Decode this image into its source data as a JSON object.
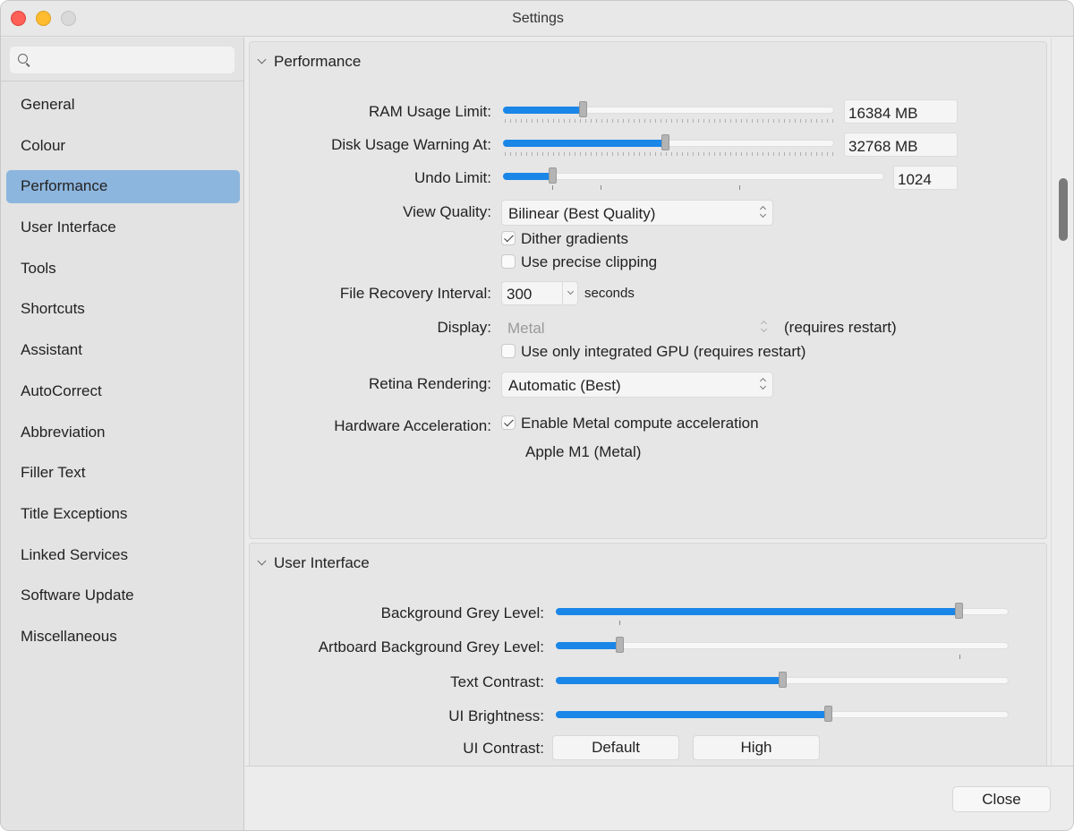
{
  "window": {
    "title": "Settings"
  },
  "search": {
    "placeholder": ""
  },
  "sidebar": {
    "items": [
      {
        "label": "General"
      },
      {
        "label": "Colour"
      },
      {
        "label": "Performance",
        "active": true
      },
      {
        "label": "User Interface"
      },
      {
        "label": "Tools"
      },
      {
        "label": "Shortcuts"
      },
      {
        "label": "Assistant"
      },
      {
        "label": "AutoCorrect"
      },
      {
        "label": "Abbreviation"
      },
      {
        "label": "Filler Text"
      },
      {
        "label": "Title Exceptions"
      },
      {
        "label": "Linked Services"
      },
      {
        "label": "Software Update"
      },
      {
        "label": "Miscellaneous"
      }
    ]
  },
  "performance": {
    "header": "Performance",
    "ram": {
      "label": "RAM Usage Limit:",
      "value": "16384 MB",
      "level": 0.24
    },
    "disk": {
      "label": "Disk Usage Warning At:",
      "value": "32768 MB",
      "level": 0.49
    },
    "undo": {
      "label": "Undo Limit:",
      "value": "1024",
      "level": 0.13
    },
    "view_quality": {
      "label": "View Quality:",
      "value": "Bilinear (Best Quality)"
    },
    "dither": {
      "label": "Dither gradients",
      "checked": true
    },
    "precise_clipping": {
      "label": "Use precise clipping",
      "checked": false
    },
    "file_recovery": {
      "label": "File Recovery Interval:",
      "value": "300",
      "unit": "seconds"
    },
    "display": {
      "label": "Display:",
      "value": "Metal",
      "note": "(requires restart)"
    },
    "integrated_gpu": {
      "label": "Use only integrated GPU (requires restart)",
      "checked": false
    },
    "retina": {
      "label": "Retina Rendering:",
      "value": "Automatic (Best)"
    },
    "hw_accel": {
      "label": "Hardware Acceleration:",
      "checkbox": "Enable Metal compute acceleration",
      "checked": true,
      "device": "Apple M1 (Metal)"
    }
  },
  "user_interface": {
    "header": "User Interface",
    "bg_grey": {
      "label": "Background Grey Level:",
      "level": 0.89
    },
    "artboard_grey": {
      "label": "Artboard Background Grey Level:",
      "level": 0.14
    },
    "text_contrast": {
      "label": "Text Contrast:",
      "level": 0.5
    },
    "ui_brightness": {
      "label": "UI Brightness:",
      "level": 0.6
    },
    "ui_contrast": {
      "label": "UI Contrast:",
      "options": [
        "Default",
        "High"
      ]
    }
  },
  "footer": {
    "close_label": "Close"
  },
  "colors": {
    "accent": "#1a86e8",
    "selection": "#8db6de"
  }
}
